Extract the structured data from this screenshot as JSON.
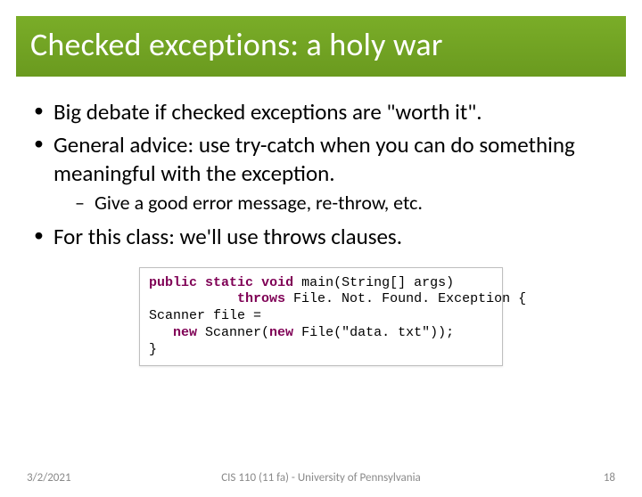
{
  "title": "Checked exceptions: a holy war",
  "bullets": {
    "b1": "Big debate if checked exceptions are \"worth it\".",
    "b2": "General advice: use try-catch when you can do something meaningful with the exception.",
    "b2a": "Give a good error message, re-throw, etc.",
    "b3": "For this class: we'll use throws clauses."
  },
  "code": {
    "kw_public": "public",
    "kw_static": "static",
    "kw_void": "void",
    "sig_main": " main(String[] args)",
    "indent1": "           ",
    "kw_throws": "throws",
    "throws_rest": " File. Not. Found. Exception {",
    "line3a": "Scanner file =",
    "indent2": "   ",
    "kw_new1": "new",
    "line4a": " Scanner(",
    "kw_new2": "new",
    "line4b": " File(\"data. txt\"));",
    "line5": "}"
  },
  "footer": {
    "date": "3/2/2021",
    "course": "CIS 110 (11 fa) - University of Pennsylvania",
    "page": "18"
  }
}
